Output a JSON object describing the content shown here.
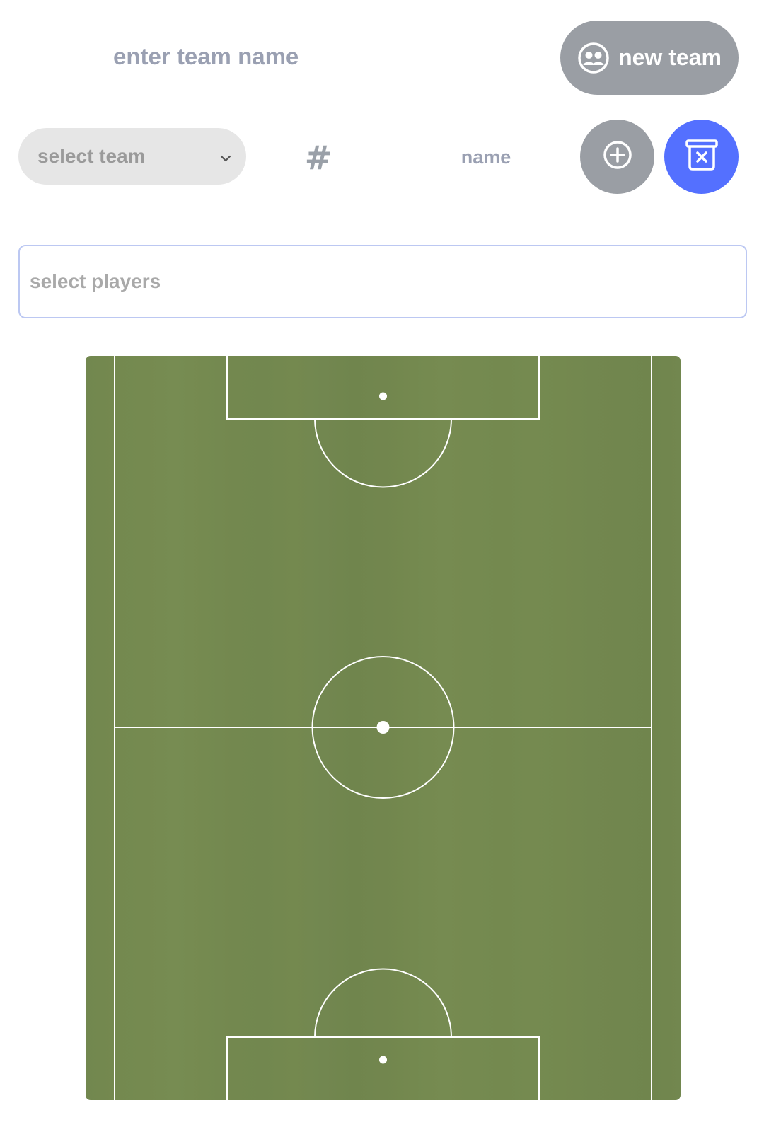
{
  "header": {
    "team_name_placeholder": "enter team name",
    "new_team_label": "new team"
  },
  "controls": {
    "team_select_label": "select team",
    "number_label": "#",
    "name_placeholder": "name"
  },
  "players": {
    "select_placeholder": "select players"
  },
  "icons": {
    "new_team": "group-icon",
    "add_player": "plus-circle-icon",
    "delete_team": "trash-x-icon",
    "dropdown": "chevron-down-icon"
  },
  "colors": {
    "accent": "#5470ff",
    "button_gray": "#9a9ea4",
    "pitch_green": "#72874f",
    "divider": "#aebdf0"
  }
}
